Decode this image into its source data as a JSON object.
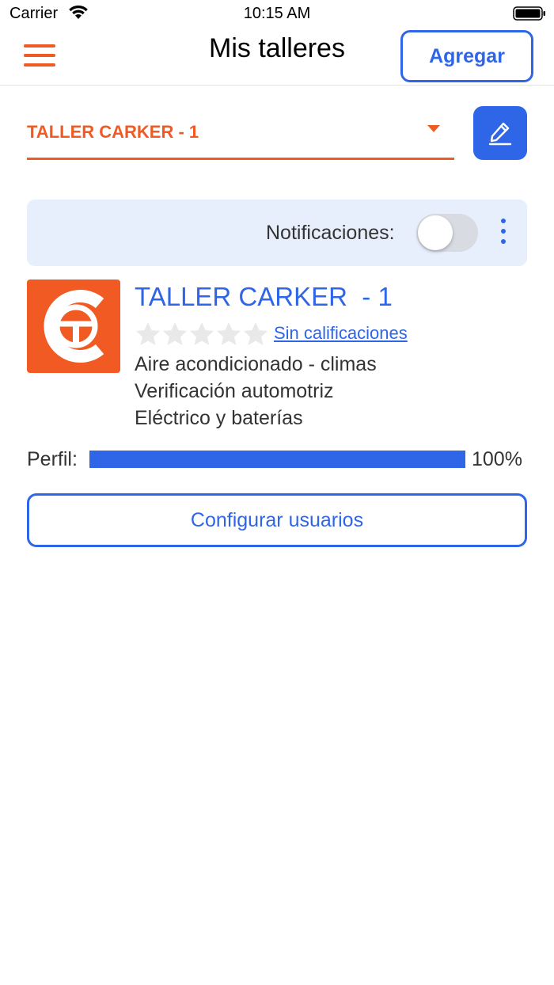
{
  "status_bar": {
    "carrier": "Carrier",
    "time": "10:15 AM"
  },
  "header": {
    "title": "Mis talleres",
    "add_label": "Agregar"
  },
  "selector": {
    "selected": "TALLER CARKER - 1"
  },
  "notifications": {
    "label": "Notificaciones:",
    "enabled": false
  },
  "workshop": {
    "name": "TALLER CARKER  - 1",
    "rating_stars": 0,
    "rating_max": 5,
    "rating_label": "Sin calificaciones",
    "services": [
      "Aire acondicionado - climas",
      "Verificación automotriz",
      "Eléctrico y baterías"
    ]
  },
  "profile": {
    "label": "Perfil:",
    "percent": 100,
    "percent_text": "100%"
  },
  "actions": {
    "configure_users": "Configurar usuarios"
  },
  "colors": {
    "accent_orange": "#f15a22",
    "accent_blue": "#2f66e8",
    "notif_bg": "#e8effc"
  },
  "icons": {
    "menu": "hamburger-icon",
    "edit": "pencil-icon",
    "more": "vertical-dots-icon",
    "caret": "caret-down-icon",
    "star": "star-icon"
  }
}
